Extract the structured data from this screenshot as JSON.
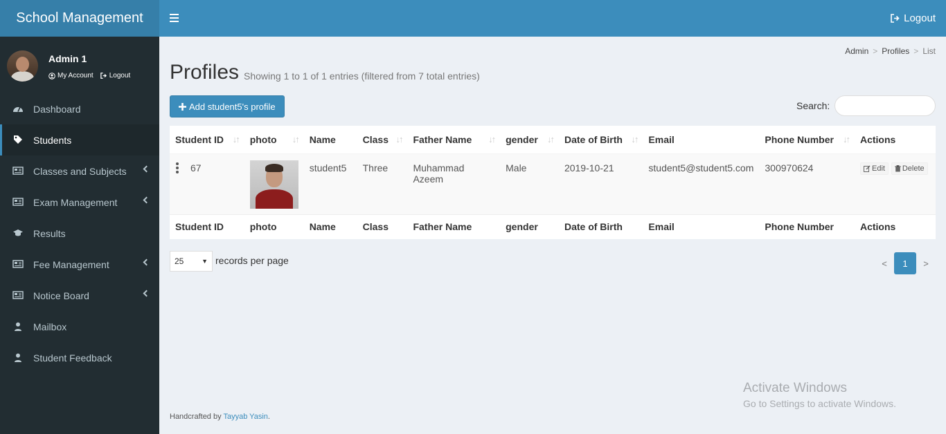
{
  "app": {
    "title": "School Management"
  },
  "header": {
    "logout_label": "Logout"
  },
  "user": {
    "name": "Admin 1",
    "my_account": "My Account",
    "logout": "Logout"
  },
  "sidebar": {
    "items": [
      {
        "label": "Dashboard",
        "icon": "dashboard-icon"
      },
      {
        "label": "Students",
        "icon": "tag-icon",
        "active": true
      },
      {
        "label": "Classes and Subjects",
        "icon": "newspaper-icon"
      },
      {
        "label": "Exam Management",
        "icon": "newspaper-icon"
      },
      {
        "label": "Results",
        "icon": "graduation-cap-icon"
      },
      {
        "label": "Fee Management",
        "icon": "newspaper-icon"
      },
      {
        "label": "Notice Board",
        "icon": "newspaper-icon"
      },
      {
        "label": "Mailbox",
        "icon": "user-icon"
      },
      {
        "label": "Student Feedback",
        "icon": "user-icon"
      }
    ]
  },
  "breadcrumb": {
    "items": [
      "Admin",
      "Profiles",
      "List"
    ],
    "separator": ">"
  },
  "page": {
    "title": "Profiles",
    "subtitle": "Showing 1 to 1 of 1 entries (filtered from 7 total entries)",
    "add_button": "Add student5's profile"
  },
  "search": {
    "label": "Search:",
    "value": ""
  },
  "table": {
    "headers": [
      "Student ID",
      "photo",
      "Name",
      "Class",
      "Father Name",
      "gender",
      "Date of Birth",
      "Email",
      "Phone Number",
      "Actions"
    ],
    "rows": [
      {
        "student_id": "67",
        "name": "student5",
        "class": "Three",
        "father_name": "Muhammad Azeem",
        "gender": "Male",
        "dob": "2019-10-21",
        "email": "student5@student5.com",
        "phone": "300970624",
        "edit": "Edit",
        "delete": "Delete"
      }
    ]
  },
  "length": {
    "value": "25",
    "label": "records per page"
  },
  "pagination": {
    "prev": "<",
    "current": "1",
    "next": ">"
  },
  "watermark": {
    "line1": "Activate Windows",
    "line2": "Go to Settings to activate Windows."
  },
  "footer": {
    "prefix": "Handcrafted by",
    "author": "Tayyab Yasin",
    "suffix": "."
  },
  "colors": {
    "primary": "#3c8dbc",
    "logo_bg": "#367fa9",
    "sidebar_bg": "#222d32"
  }
}
